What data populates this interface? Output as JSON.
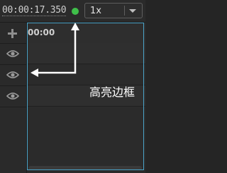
{
  "toolbar": {
    "timecode": "00:00:17.350",
    "status_color": "#3fbf4a",
    "speed": {
      "selected": "1x"
    }
  },
  "gutter": {
    "add_icon": "plus-icon",
    "rows": [
      {
        "icon": "eye-icon"
      },
      {
        "icon": "eye-icon"
      },
      {
        "icon": "eye-icon"
      }
    ]
  },
  "timeline": {
    "ruler_label": "00:00",
    "highlight_color": "#4aa3c8"
  },
  "annotation": {
    "label": "高亮边框"
  }
}
